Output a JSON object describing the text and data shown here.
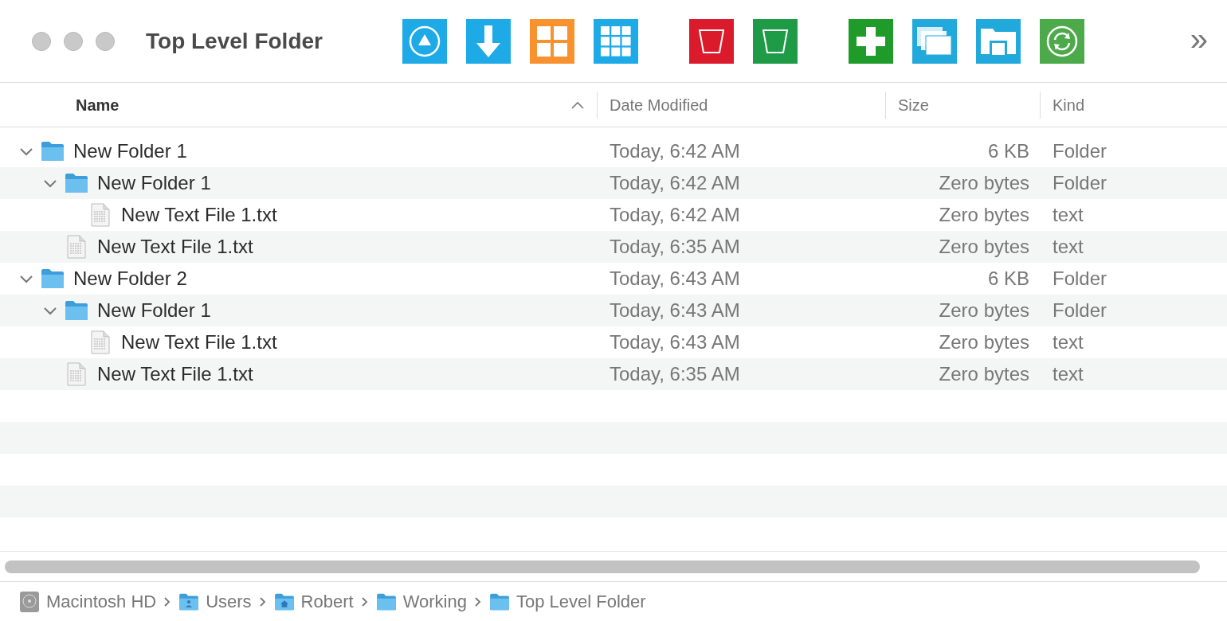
{
  "window": {
    "title": "Top Level Folder"
  },
  "toolbar": [
    [
      {
        "kind": "up",
        "color": "#1eaae7"
      },
      {
        "kind": "down",
        "color": "#1eaae7"
      },
      {
        "kind": "grid4",
        "color": "#f7922f"
      },
      {
        "kind": "grid9",
        "color": "#1eaae7"
      }
    ],
    [
      {
        "kind": "trash",
        "color": "#db1a2c"
      },
      {
        "kind": "trash",
        "color": "#1f9b48"
      }
    ],
    [
      {
        "kind": "plus",
        "color": "#1f9b2a"
      },
      {
        "kind": "windows",
        "color": "#22a9db"
      },
      {
        "kind": "folder",
        "color": "#22a9db"
      },
      {
        "kind": "sync",
        "color": "#4daa4a"
      }
    ]
  ],
  "overflow": "»",
  "columns": [
    {
      "label": "Name",
      "sorted": true
    },
    {
      "label": "Date Modified",
      "sorted": false
    },
    {
      "label": "Size",
      "sorted": false
    },
    {
      "label": "Kind",
      "sorted": false
    }
  ],
  "rows": [
    {
      "kind": "folder",
      "name": "New Folder 1",
      "date": "Today, 6:42 AM",
      "size": "6 KB",
      "type": "Folder",
      "expanded": true,
      "children": [
        {
          "kind": "folder",
          "name": "New Folder 1",
          "date": "Today, 6:42 AM",
          "size": "Zero bytes",
          "type": "Folder",
          "expanded": true,
          "children": [
            {
              "kind": "file",
              "name": "New Text File 1.txt",
              "date": "Today, 6:42 AM",
              "size": "Zero bytes",
              "type": "text"
            }
          ]
        },
        {
          "kind": "file",
          "name": "New Text File 1.txt",
          "date": "Today, 6:35 AM",
          "size": "Zero bytes",
          "type": "text"
        }
      ]
    },
    {
      "kind": "folder",
      "name": "New Folder 2",
      "date": "Today, 6:43 AM",
      "size": "6 KB",
      "type": "Folder",
      "expanded": true,
      "children": [
        {
          "kind": "folder",
          "name": "New Folder 1",
          "date": "Today, 6:43 AM",
          "size": "Zero bytes",
          "type": "Folder",
          "expanded": true,
          "children": [
            {
              "kind": "file",
              "name": "New Text File 1.txt",
              "date": "Today, 6:43 AM",
              "size": "Zero bytes",
              "type": "text"
            }
          ]
        },
        {
          "kind": "file",
          "name": "New Text File 1.txt",
          "date": "Today, 6:35 AM",
          "size": "Zero bytes",
          "type": "text"
        }
      ]
    }
  ],
  "path_bar": [
    {
      "kind": "disk",
      "label": "Macintosh HD"
    },
    {
      "kind": "user",
      "label": "Users"
    },
    {
      "kind": "home",
      "label": "Robert"
    },
    {
      "kind": "folder",
      "label": "Working"
    },
    {
      "kind": "folder",
      "label": "Top Level Folder"
    }
  ]
}
